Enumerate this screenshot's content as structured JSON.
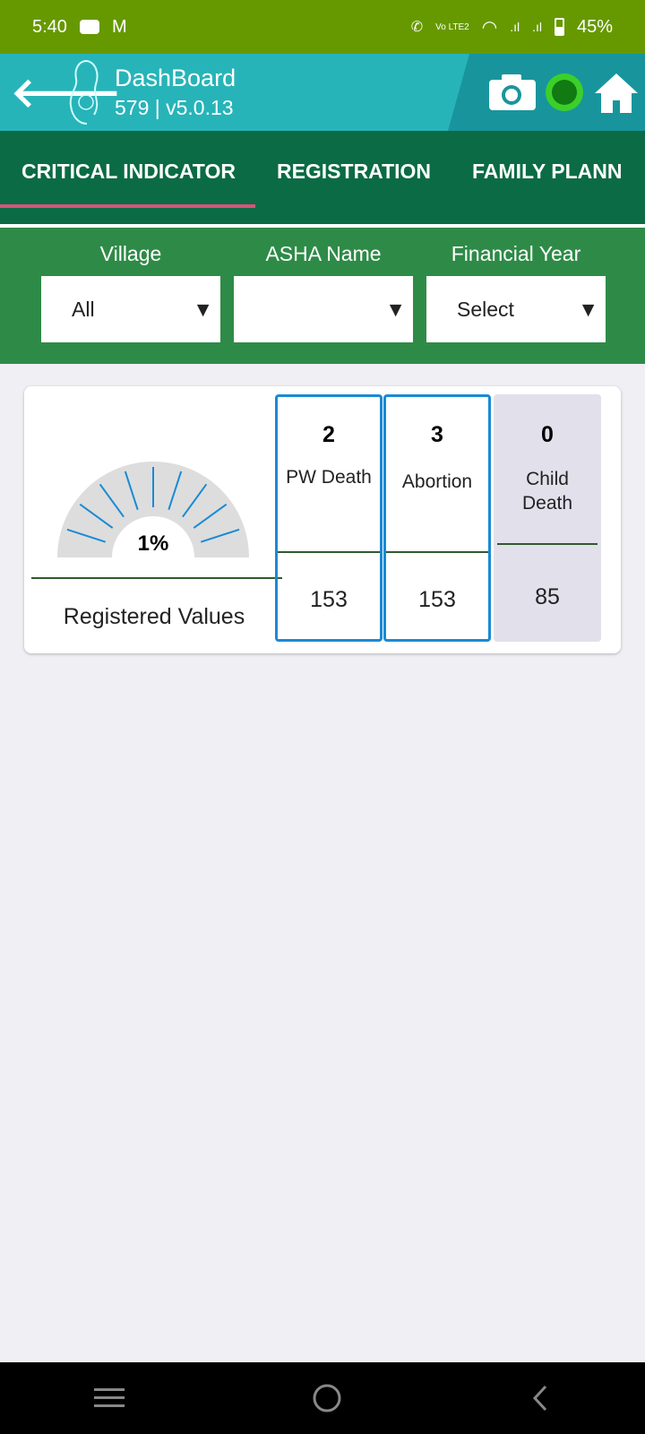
{
  "status_bar": {
    "time": "5:40",
    "battery": "45%",
    "icons": [
      "youtube-icon",
      "gmail-icon",
      "wifi-calling-icon",
      "volte-icon",
      "wifi-icon",
      "signal-icon",
      "signal-icon",
      "battery-icon"
    ]
  },
  "app_bar": {
    "title": "DashBoard",
    "subtitle": "579 | v5.0.13"
  },
  "tabs": [
    {
      "label": "CRITICAL INDICATOR",
      "active": true
    },
    {
      "label": "REGISTRATION"
    },
    {
      "label": "FAMILY PLANN"
    }
  ],
  "filters": [
    {
      "label": "Village",
      "value": "All"
    },
    {
      "label": "ASHA Name",
      "value": ""
    },
    {
      "label": "Financial Year",
      "value": "Select"
    }
  ],
  "gauge": {
    "percent": 1,
    "label": "1%",
    "caption": "Registered Values",
    "colors": {
      "track": "#dddddd",
      "ticks": "#1a8ad4"
    }
  },
  "indicators": [
    {
      "count": "2",
      "label": "PW Death",
      "registered": "153"
    },
    {
      "count": "3",
      "label": "Abortion",
      "registered": "153"
    },
    {
      "count": "0",
      "label": "Child Death",
      "registered": "85"
    }
  ],
  "colors": {
    "status": "#669900",
    "appbar": "#27b4b8",
    "tabs": "#0b6b44",
    "filters": "#2e8b47",
    "tab_indicator": "#d6557a",
    "card_border": "#1a8ad4"
  }
}
